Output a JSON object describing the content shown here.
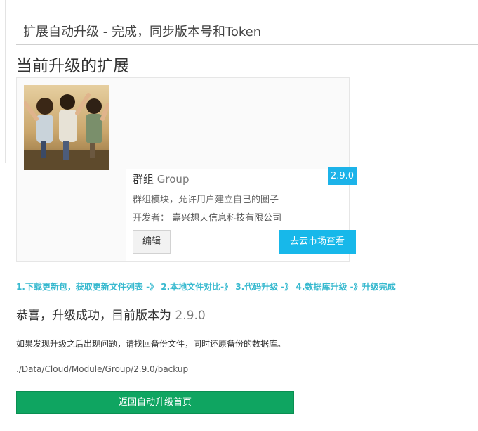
{
  "header": {
    "title": "扩展自动升级 - 完成，同步版本号和Token"
  },
  "section": {
    "title": "当前升级的扩展"
  },
  "extension": {
    "name_cn": "群组",
    "name_en": "Group",
    "version": "2.9.0",
    "description": "群组模块，允许用户建立自己的圈子",
    "developer_label": "开发者：",
    "developer_name": "嘉兴想天信息科技有限公司",
    "edit_label": "编辑",
    "market_label": "去云市场查看",
    "thumbnail_icon": "group-photo"
  },
  "steps_text": "1.下载更新包，获取更新文件列表 -》 2.本地文件对比-》 3.代码升级 -》 4.数据库升级 -》升级完成",
  "result": {
    "success_prefix": "恭喜，升级成功，目前版本为",
    "version": "2.9.0",
    "hint": "如果发现升级之后出现问题，请找回备份文件，同时还原备份的数据库。",
    "backup_path": "./Data/Cloud/Module/Group/2.9.0/backup",
    "back_label": "返回自动升级首页"
  },
  "colors": {
    "accent_blue": "#17b8ea",
    "steps_teal": "#37b9cf",
    "success_green": "#0fa561"
  }
}
